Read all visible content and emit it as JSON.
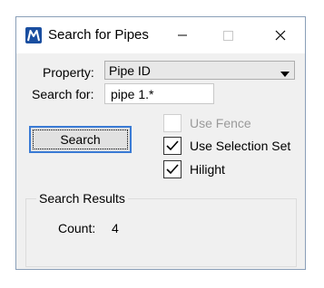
{
  "window": {
    "title": "Search for Pipes",
    "app_icon": "microstation-m-icon",
    "controls": [
      "minimize-icon",
      "maximize-icon",
      "close-icon"
    ]
  },
  "form": {
    "property_label": "Property:",
    "property_value": "Pipe ID",
    "search_for_label": "Search for:",
    "search_for_value": "pipe 1.*",
    "search_button": "Search"
  },
  "options": {
    "use_fence": {
      "label": "Use Fence",
      "checked": false,
      "enabled": false
    },
    "use_selection_set": {
      "label": "Use Selection Set",
      "checked": true,
      "enabled": true
    },
    "hilight": {
      "label": "Hilight",
      "checked": true,
      "enabled": true
    }
  },
  "results": {
    "group_title": "Search Results",
    "count_label": "Count:",
    "count_value": "4"
  },
  "colors": {
    "accent": "#3a7bd5",
    "icon_blue": "#1a4ea0",
    "window_bg": "#f0f0f0"
  }
}
